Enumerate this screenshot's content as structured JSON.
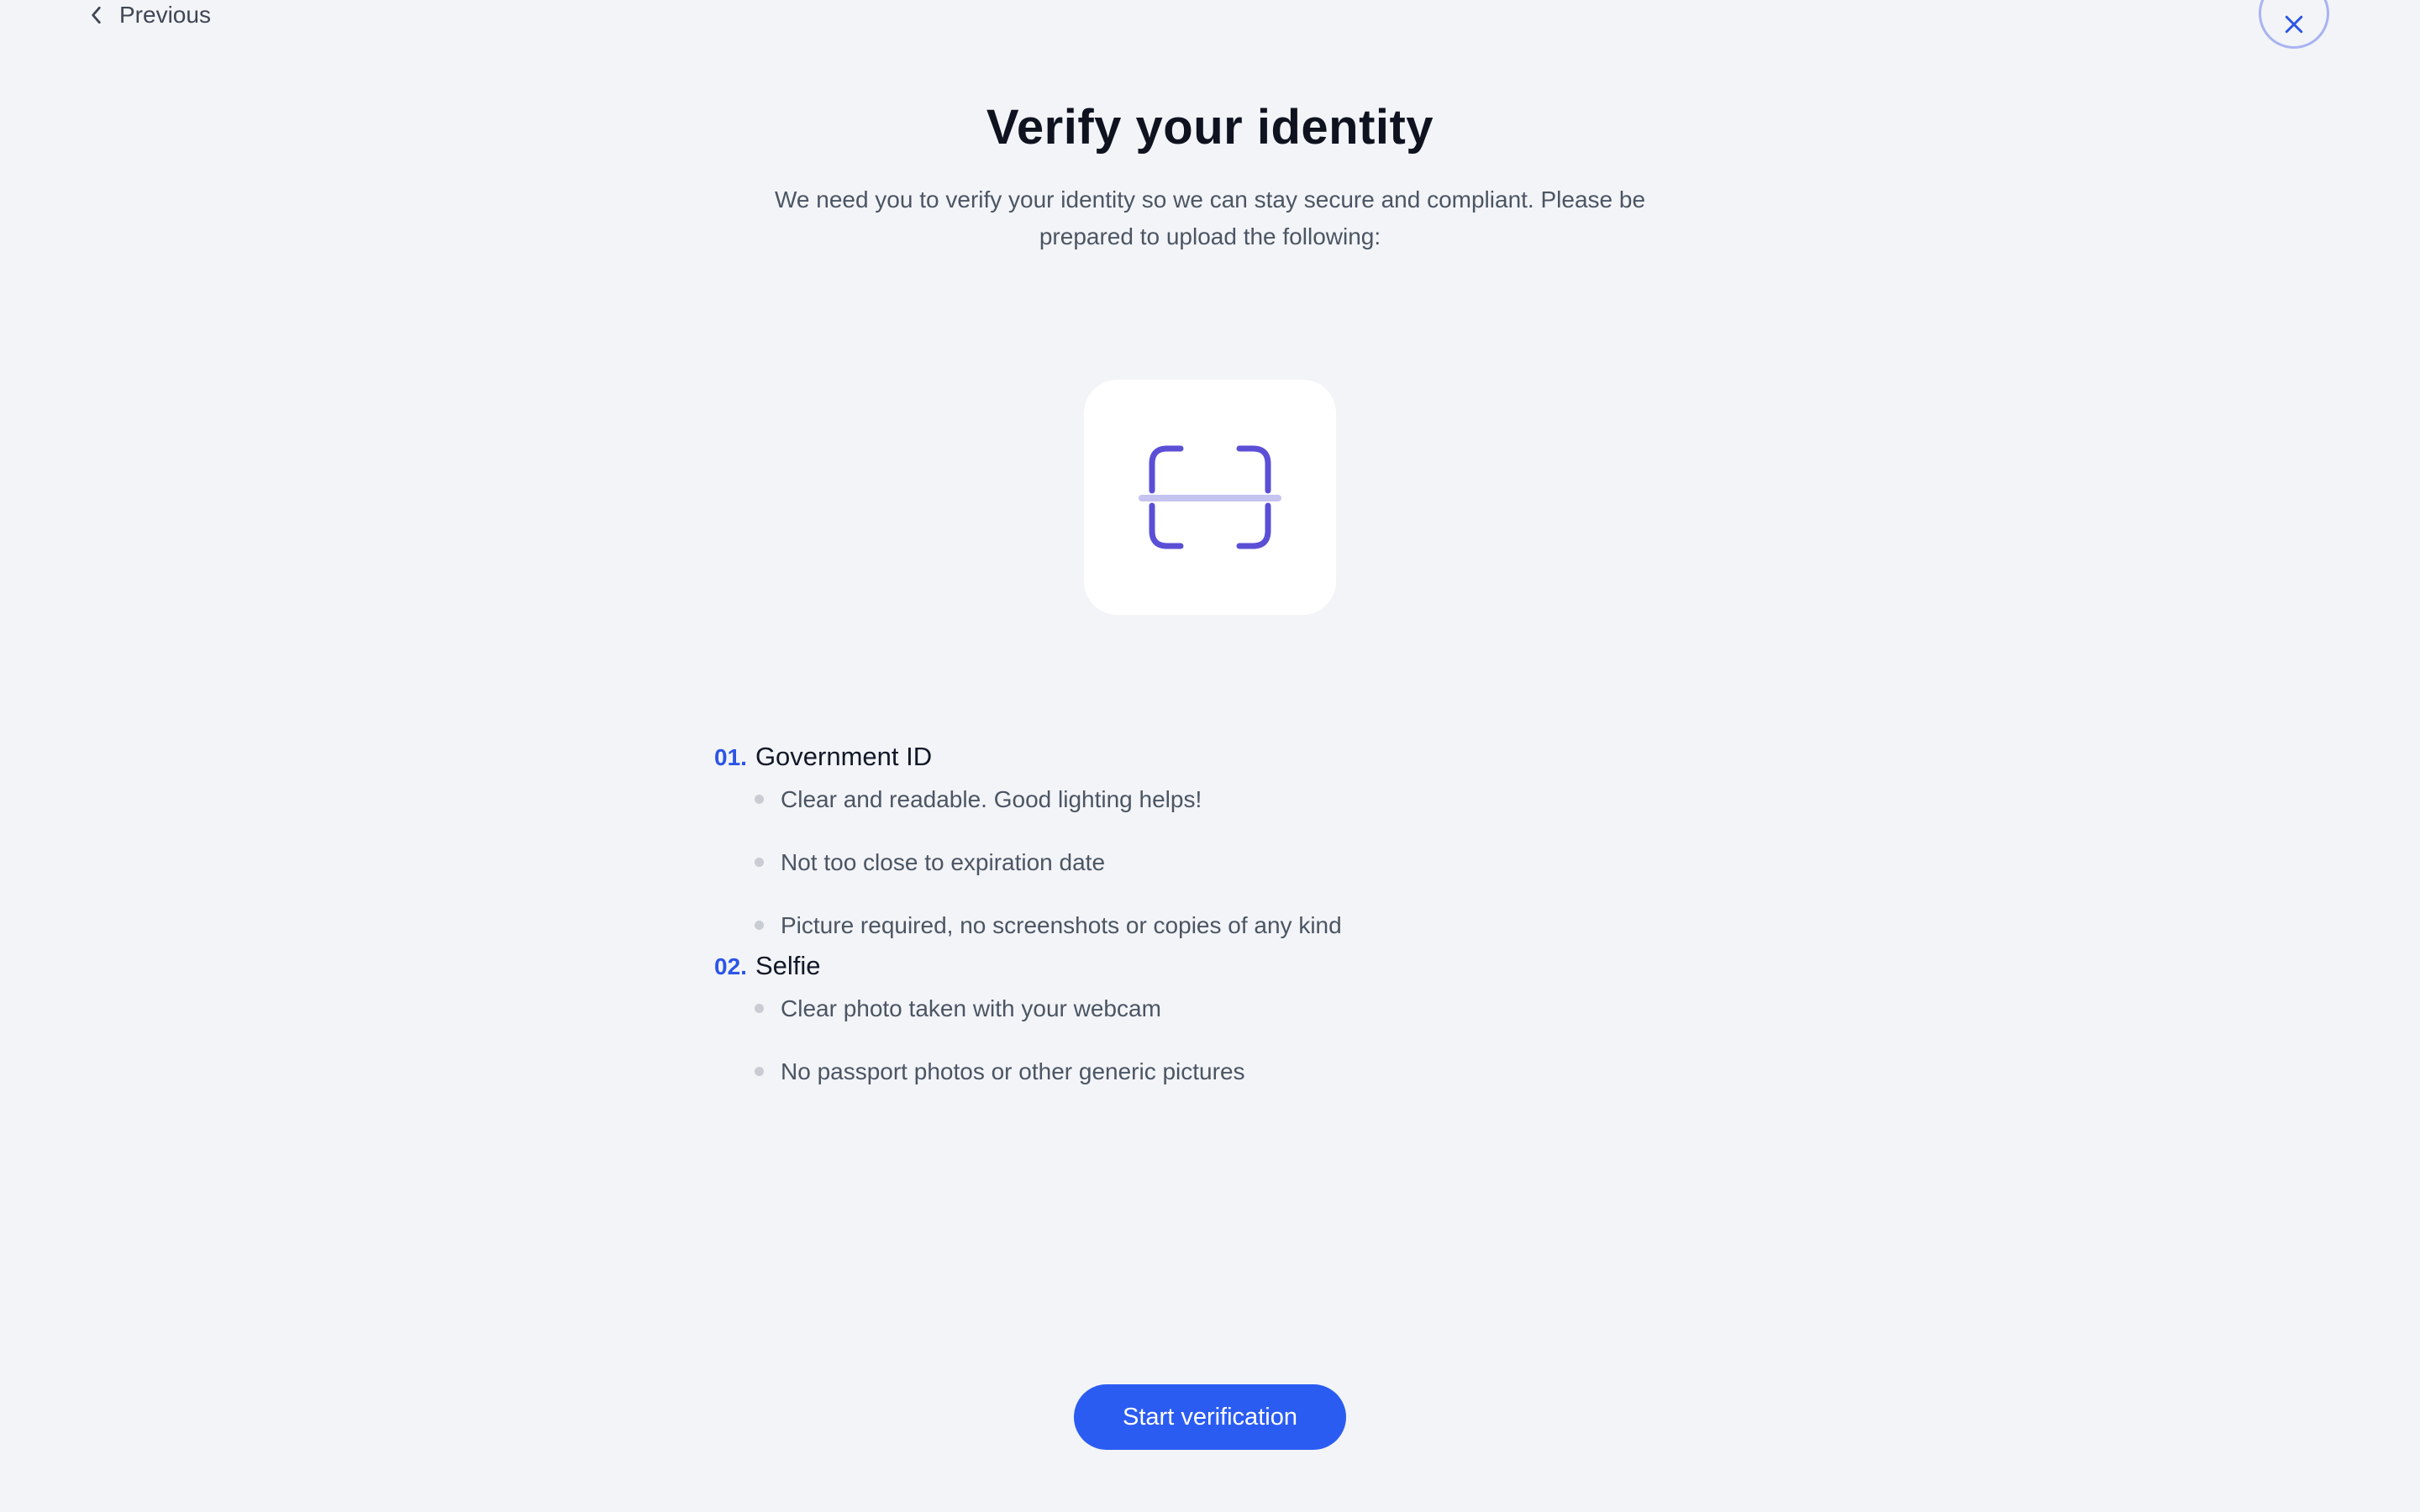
{
  "nav": {
    "previous_label": "Previous"
  },
  "header": {
    "title": "Verify your identity",
    "subtitle": "We need you to verify your identity so we can stay secure and compliant. Please be prepared to upload the following:"
  },
  "illustration": {
    "icon": "scan-icon",
    "accent_color": "#5b4fd6"
  },
  "requirements": [
    {
      "number": "01.",
      "title": "Government ID",
      "items": [
        "Clear and readable. Good lighting helps!",
        "Not too close to expiration date",
        "Picture required, no screenshots or copies of any kind"
      ]
    },
    {
      "number": "02.",
      "title": "Selfie",
      "items": [
        "Clear photo taken with your webcam",
        "No passport photos or other generic pictures"
      ]
    }
  ],
  "actions": {
    "start_label": "Start verification"
  },
  "colors": {
    "primary": "#2b5cf2",
    "background": "#f3f4f8"
  }
}
